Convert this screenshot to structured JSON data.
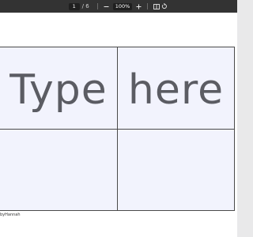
{
  "toolbar": {
    "current_page": "1",
    "page_separator": "/",
    "total_pages": "6",
    "zoom_out_icon": "minus-icon",
    "zoom_level": "100%",
    "zoom_in_icon": "plus-icon",
    "fit_page_icon": "fit-page-icon",
    "rotate_icon": "rotate-icon"
  },
  "document": {
    "cells": [
      {
        "text": "Type"
      },
      {
        "text": "here"
      },
      {
        "text": ""
      },
      {
        "text": ""
      }
    ],
    "footer_credit": "byHannah"
  }
}
